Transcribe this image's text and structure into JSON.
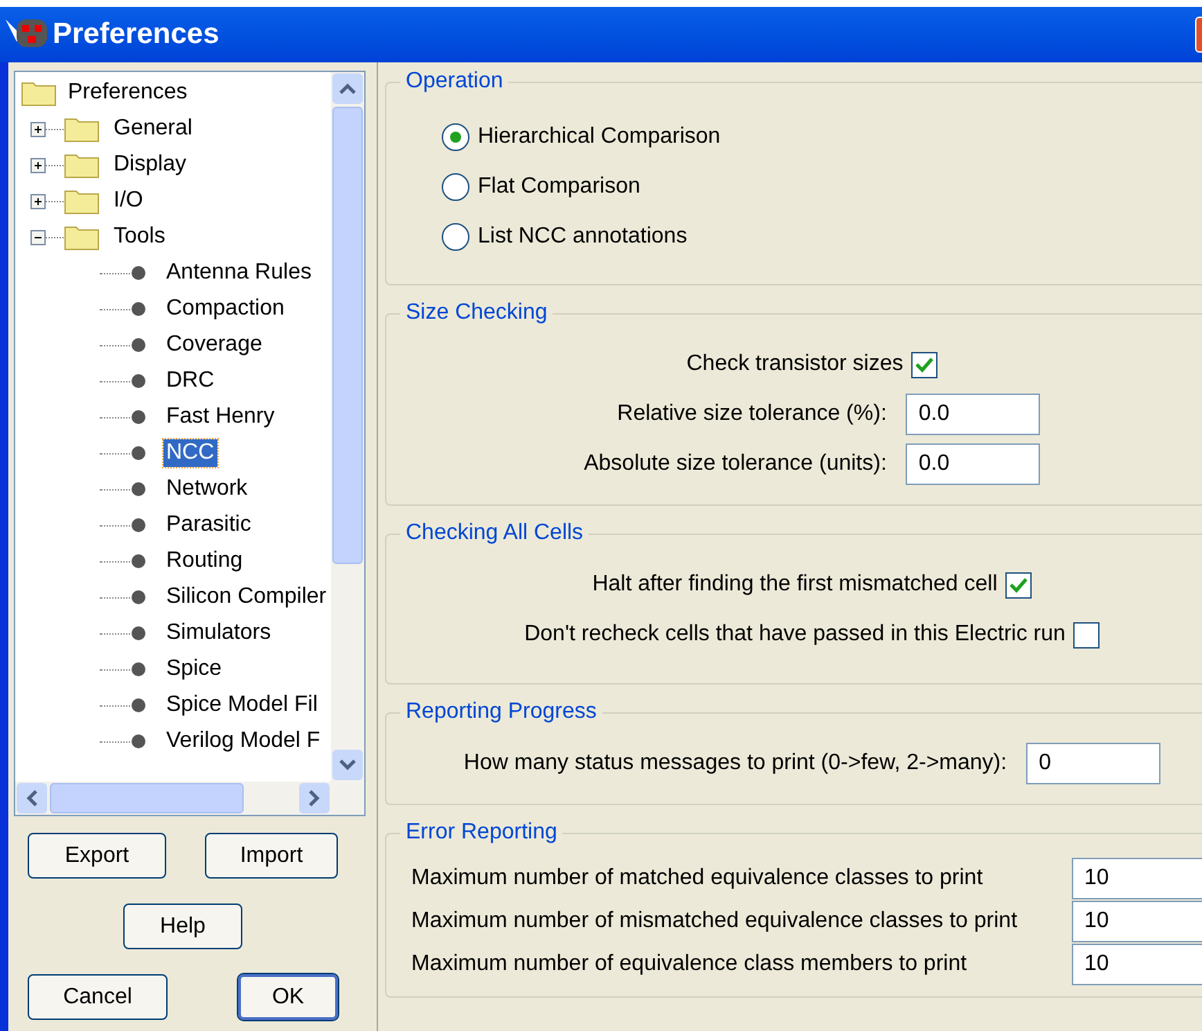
{
  "window": {
    "title": "Preferences"
  },
  "tree": {
    "items": [
      {
        "label": "Preferences",
        "kind": "root",
        "selected": false,
        "children": [
          {
            "label": "General",
            "kind": "folder",
            "expanded": false,
            "selected": false
          },
          {
            "label": "Display",
            "kind": "folder",
            "expanded": false,
            "selected": false
          },
          {
            "label": "I/O",
            "kind": "folder",
            "expanded": false,
            "selected": false
          },
          {
            "label": "Tools",
            "kind": "folder",
            "expanded": true,
            "selected": false,
            "children": [
              {
                "label": "Antenna Rules",
                "kind": "leaf",
                "selected": false
              },
              {
                "label": "Compaction",
                "kind": "leaf",
                "selected": false
              },
              {
                "label": "Coverage",
                "kind": "leaf",
                "selected": false
              },
              {
                "label": "DRC",
                "kind": "leaf",
                "selected": false
              },
              {
                "label": "Fast Henry",
                "kind": "leaf",
                "selected": false
              },
              {
                "label": "NCC",
                "kind": "leaf",
                "selected": true
              },
              {
                "label": "Network",
                "kind": "leaf",
                "selected": false
              },
              {
                "label": "Parasitic",
                "kind": "leaf",
                "selected": false
              },
              {
                "label": "Routing",
                "kind": "leaf",
                "selected": false
              },
              {
                "label": "Silicon Compiler",
                "kind": "leaf",
                "selected": false
              },
              {
                "label": "Simulators",
                "kind": "leaf",
                "selected": false
              },
              {
                "label": "Spice",
                "kind": "leaf",
                "selected": false
              },
              {
                "label": "Spice Model Fil",
                "kind": "leaf",
                "selected": false
              },
              {
                "label": "Verilog Model F",
                "kind": "leaf",
                "selected": false
              }
            ]
          }
        ]
      }
    ]
  },
  "buttons": [
    {
      "label": "Export",
      "default": false
    },
    {
      "label": "Import",
      "default": false
    },
    {
      "label": "Help",
      "default": false
    },
    {
      "label": "Cancel",
      "default": false
    },
    {
      "label": "OK",
      "default": true
    }
  ],
  "sections": [
    {
      "title": "Operation",
      "kind": "radios",
      "rows": [
        {
          "kind": "radio",
          "label": "Hierarchical Comparison",
          "selected": true
        },
        {
          "kind": "radio",
          "label": "Flat Comparison",
          "selected": false
        },
        {
          "kind": "radio",
          "label": "List NCC annotations",
          "selected": false
        }
      ]
    },
    {
      "title": "Size Checking",
      "kind": "centered",
      "rows": [
        {
          "kind": "checkbox",
          "label": "Check transistor sizes",
          "checked": true
        },
        {
          "kind": "field",
          "label": "Relative size tolerance  (%):",
          "value": "0.0"
        },
        {
          "kind": "field",
          "label": "Absolute size tolerance (units):",
          "value": "0.0"
        }
      ]
    },
    {
      "title": "Checking All Cells",
      "kind": "centered",
      "rows": [
        {
          "kind": "checkbox",
          "label": "Halt after finding the first mismatched cell",
          "checked": true
        },
        {
          "kind": "checkbox",
          "label": "Don't recheck cells that have passed in this Electric run",
          "checked": false
        }
      ]
    },
    {
      "title": "Reporting Progress",
      "kind": "centered",
      "rows": [
        {
          "kind": "field",
          "label": "How many status messages to print (0->few, 2->many):",
          "value": "0"
        }
      ]
    },
    {
      "title": "Error Reporting",
      "kind": "table",
      "rows": [
        {
          "kind": "field",
          "label": "Maximum number of matched equivalence classes to print",
          "value": "10"
        },
        {
          "kind": "field",
          "label": "Maximum number of mismatched equivalence classes to print",
          "value": "10"
        },
        {
          "kind": "field",
          "label": "Maximum number of equivalence class members to print",
          "value": "10"
        }
      ]
    }
  ]
}
